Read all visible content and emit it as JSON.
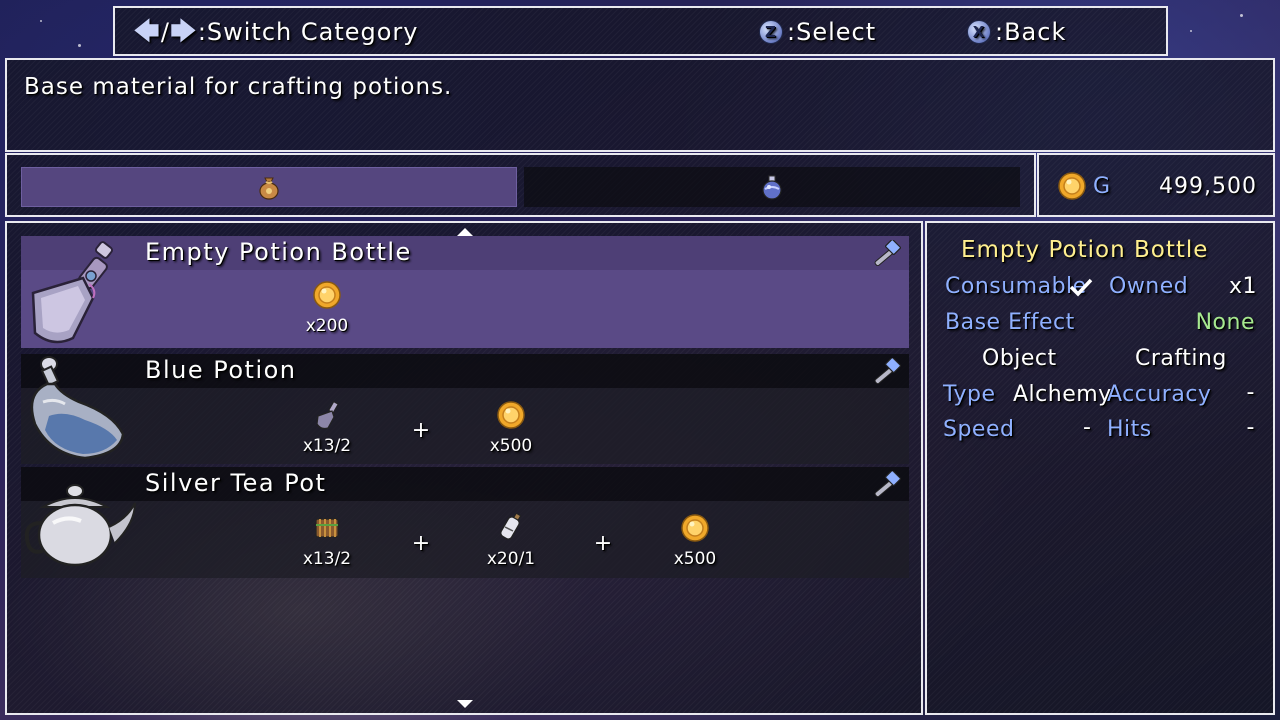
{
  "help_bar": {
    "switch_label": ":Switch Category",
    "select_key": "Z",
    "select_label": ":Select",
    "back_key": "X",
    "back_label": ":Back",
    "arrow_slash": "/"
  },
  "description": "Base material for crafting potions.",
  "categories": [
    {
      "icon": "material-bag-icon",
      "selected": true
    },
    {
      "icon": "potion-flask-icon",
      "selected": false
    }
  ],
  "gold": {
    "label": "G",
    "value": "499,500"
  },
  "recipes": [
    {
      "name": "Empty Potion Bottle",
      "icon": "empty-potion-bottle-icon",
      "selected": true,
      "ingredients": [
        {
          "icon": "gold-coin-icon",
          "count": "x200"
        }
      ]
    },
    {
      "name": "Blue Potion",
      "icon": "blue-potion-icon",
      "selected": false,
      "ingredients": [
        {
          "icon": "empty-bottle-small-icon",
          "count": "x13/2"
        },
        {
          "icon": "gold-coin-icon",
          "count": "x500"
        }
      ]
    },
    {
      "name": "Silver Tea Pot",
      "icon": "silver-tea-pot-icon",
      "selected": false,
      "ingredients": [
        {
          "icon": "wood-bundle-icon",
          "count": "x13/2"
        },
        {
          "icon": "bottle-scroll-icon",
          "count": "x20/1"
        },
        {
          "icon": "gold-coin-icon",
          "count": "x500"
        }
      ]
    }
  ],
  "plus_sign": "+",
  "details": {
    "title": "Empty Potion Bottle",
    "consumable_label": "Consumable",
    "owned_label": "Owned",
    "owned_value": "x1",
    "base_effect_label": "Base Effect",
    "base_effect_value": "None",
    "object_label": "Object",
    "object_value": "Crafting",
    "type_label": "Type",
    "type_value": "Alchemy",
    "accuracy_label": "Accuracy",
    "accuracy_value": "-",
    "speed_label": "Speed",
    "speed_value": "-",
    "hits_label": "Hits",
    "hits_value": "-"
  },
  "colors": {
    "label_blue": "#8fb0ff",
    "title_yellow": "#ffef8f",
    "value_green": "#a6e88f",
    "selected_row": "#5a4a86"
  }
}
